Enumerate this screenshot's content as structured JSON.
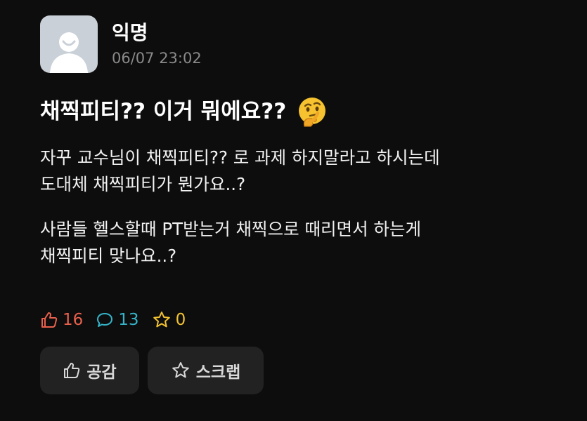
{
  "post": {
    "author": "익명",
    "timestamp": "06/07 23:02",
    "title": "채찍피티?? 이거 뭐에요??",
    "title_emoji": "thinking-face-icon",
    "paragraphs": [
      "자꾸 교수님이 채찍피티?? 로 과제 하지말라고 하시는데\n도대체 채찍피티가 뭔가요..?",
      "사람들 헬스할때 PT받는거 채찍으로 때리면서 하는게\n채찍피티 맞나요..?"
    ]
  },
  "stats": {
    "likes": "16",
    "comments": "13",
    "scraps": "0"
  },
  "actions": {
    "like_label": "공감",
    "scrap_label": "스크랩"
  },
  "colors": {
    "background": "#0d0d0d",
    "like": "#e8604c",
    "comment": "#35b3c8",
    "scrap": "#f2c230",
    "button_bg": "#222222",
    "avatar_bg": "#c9d0d8"
  }
}
